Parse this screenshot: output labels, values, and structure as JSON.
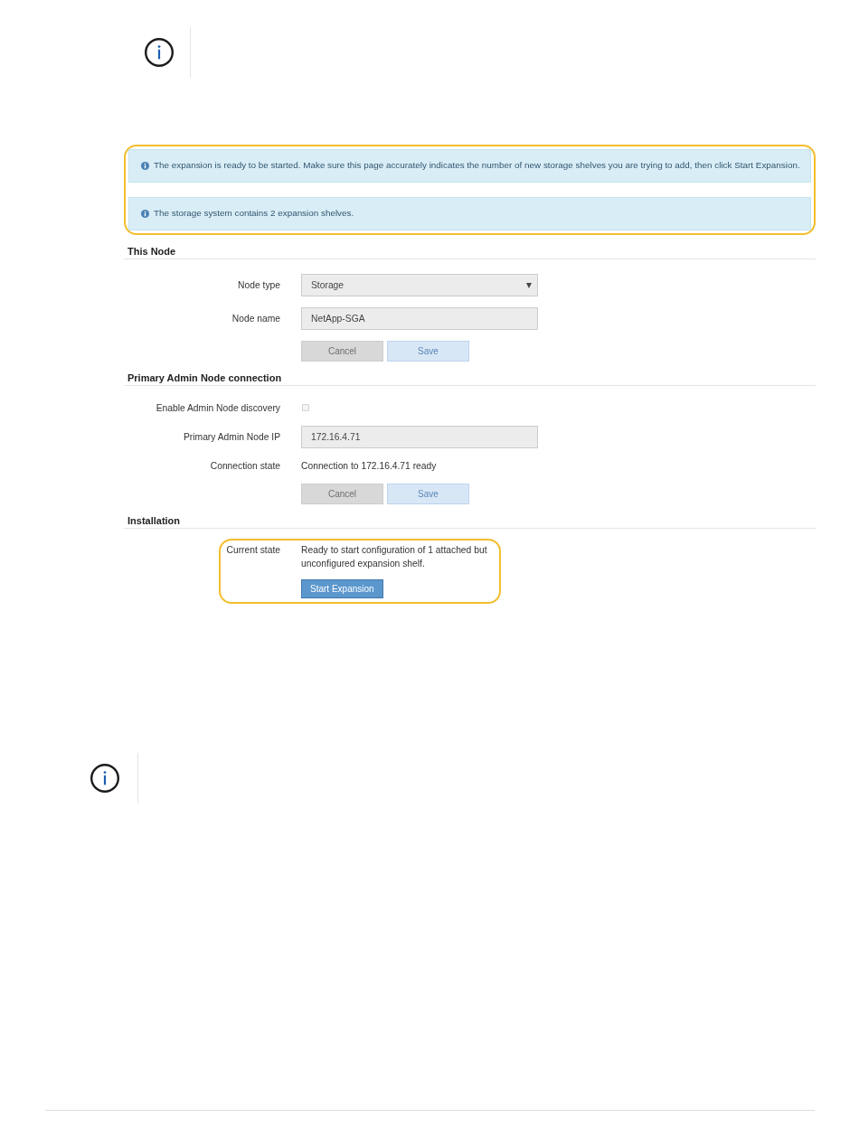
{
  "alerts_group": {
    "highlighted": true,
    "alerts": [
      {
        "text": "The expansion is ready to be started. Make sure this page accurately indicates the number of new storage shelves you are trying to add, then click Start Expansion."
      },
      {
        "text": "The storage system contains 2 expansion shelves."
      }
    ]
  },
  "sections": [
    {
      "title": "This Node",
      "rows": [
        {
          "kind": "select",
          "label": "Node type",
          "value": "Storage",
          "highlighted": false
        },
        {
          "kind": "input",
          "label": "Node name",
          "value": "NetApp-SGA",
          "highlighted": false
        },
        {
          "kind": "buttons",
          "highlighted": false,
          "buttons": [
            {
              "label": "Cancel",
              "kind": "secondary",
              "disabled": true
            },
            {
              "label": "Save",
              "kind": "primary",
              "disabled": true
            }
          ]
        }
      ]
    },
    {
      "title": "Primary Admin Node connection",
      "rows": [
        {
          "kind": "checkbox",
          "label": "Enable Admin Node discovery",
          "checked": false,
          "disabled": true,
          "highlighted": false
        },
        {
          "kind": "input",
          "label": "Primary Admin Node IP",
          "value": "172.16.4.71",
          "highlighted": false
        },
        {
          "kind": "text",
          "label": "Connection state",
          "value": "Connection to 172.16.4.71 ready",
          "highlighted": false
        },
        {
          "kind": "buttons",
          "highlighted": false,
          "buttons": [
            {
              "label": "Cancel",
              "kind": "secondary",
              "disabled": true
            },
            {
              "label": "Save",
              "kind": "primary",
              "disabled": true
            }
          ]
        }
      ]
    },
    {
      "title": "Installation",
      "rows": [
        {
          "kind": "text_action",
          "label": "Current state",
          "value": "Ready to start configuration of 1 attached but unconfigured expansion shelf.",
          "highlighted": true,
          "buttons": [
            {
              "label": "Start Expansion",
              "kind": "primary",
              "disabled": false
            }
          ]
        }
      ]
    }
  ]
}
